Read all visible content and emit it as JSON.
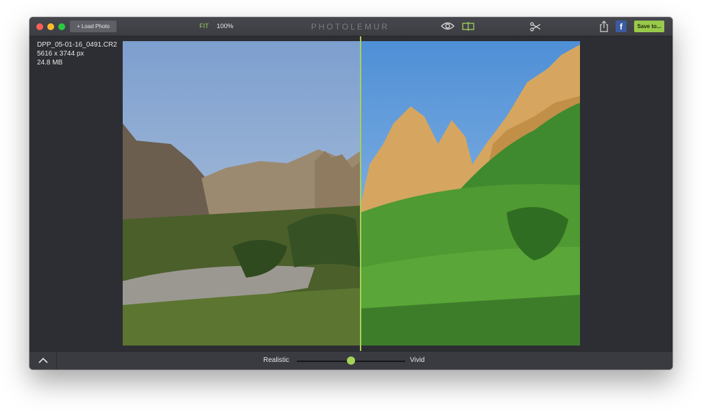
{
  "window": {
    "load_button": "+ Load Photo",
    "fit_label": "FIT",
    "zoom_label": "100%",
    "brand": "PHOTOLEMUR",
    "save_button": "Save to...",
    "facebook_glyph": "f"
  },
  "file_info": {
    "filename": "DPP_05-01-16_0491.CR2",
    "dimensions": "5616 x 3744  px",
    "size": "24.8 MB"
  },
  "slider": {
    "left_label": "Realistic",
    "right_label": "Vivid",
    "value": 0.5
  },
  "icons": [
    "eye-icon",
    "compare-split-icon",
    "scissors-icon",
    "share-icon",
    "facebook-icon",
    "chevron-up-icon"
  ],
  "colors": {
    "accent": "#a5d25a",
    "window_bg": "#2d2e33",
    "save_button": "#99c94a"
  }
}
